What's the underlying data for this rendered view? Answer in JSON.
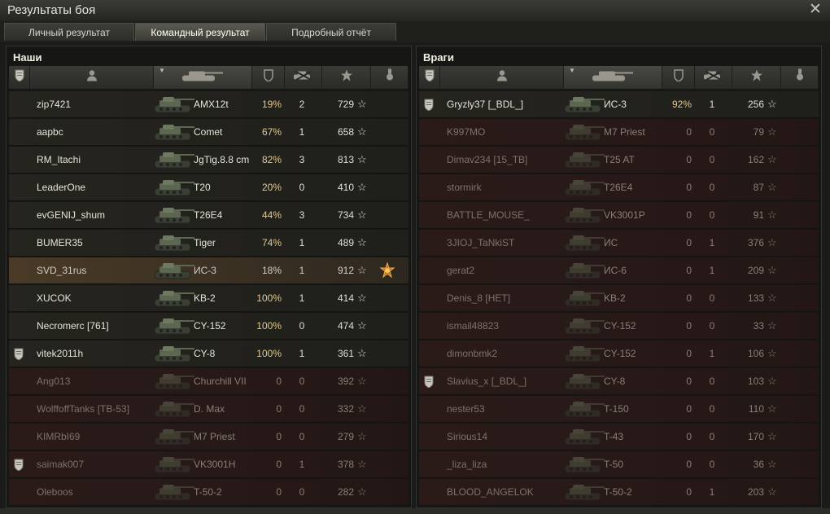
{
  "window": {
    "title": "Результаты боя",
    "close": "✕"
  },
  "tabs": [
    {
      "label": "Личный результат"
    },
    {
      "label": "Командный результат"
    },
    {
      "label": "Подробный отчёт"
    }
  ],
  "colors": {
    "accent_damage": "#e0c892",
    "dead_row": "#2a1b19",
    "own_row": "#4a3a26"
  },
  "teams": [
    {
      "title": "Наши",
      "players": [
        {
          "platoon": false,
          "name": "zip7421",
          "vehicle": "AMX12t",
          "damage": "19%",
          "kills": "2",
          "xp": "729",
          "state": "alive"
        },
        {
          "platoon": false,
          "name": "aapbc",
          "vehicle": "Comet",
          "damage": "67%",
          "kills": "1",
          "xp": "658",
          "state": "alive"
        },
        {
          "platoon": false,
          "name": "RM_Itachi",
          "vehicle": "JgTig.8.8 cm",
          "damage": "82%",
          "kills": "3",
          "xp": "813",
          "state": "alive"
        },
        {
          "platoon": false,
          "name": "LeaderOne",
          "vehicle": "T20",
          "damage": "20%",
          "kills": "0",
          "xp": "410",
          "state": "alive"
        },
        {
          "platoon": false,
          "name": "evGENIJ_shum",
          "vehicle": "T26E4",
          "damage": "44%",
          "kills": "3",
          "xp": "734",
          "state": "alive"
        },
        {
          "platoon": false,
          "name": "BUMER35",
          "vehicle": "Tiger",
          "damage": "74%",
          "kills": "1",
          "xp": "489",
          "state": "alive"
        },
        {
          "platoon": false,
          "name": "SVD_31rus",
          "vehicle": "ИС-3",
          "damage": "18%",
          "kills": "1",
          "xp": "912",
          "state": "me",
          "medal": true
        },
        {
          "platoon": false,
          "name": "XUCOK",
          "vehicle": "KB-2",
          "damage": "100%",
          "kills": "1",
          "xp": "414",
          "state": "alive"
        },
        {
          "platoon": false,
          "name": "Necromerc [761]",
          "vehicle": "CY-152",
          "damage": "100%",
          "kills": "0",
          "xp": "474",
          "state": "alive"
        },
        {
          "platoon": true,
          "name": "vitek2011h",
          "vehicle": "CY-8",
          "damage": "100%",
          "kills": "1",
          "xp": "361",
          "state": "alive"
        },
        {
          "platoon": false,
          "name": "Ang013",
          "vehicle": "Churchill VII",
          "damage": "0",
          "kills": "0",
          "xp": "392",
          "state": "dead"
        },
        {
          "platoon": false,
          "name": "WolffoffTanks [TB-53]",
          "vehicle": "D. Max",
          "damage": "0",
          "kills": "0",
          "xp": "332",
          "state": "dead"
        },
        {
          "platoon": false,
          "name": "KIMRbI69",
          "vehicle": "M7 Priest",
          "damage": "0",
          "kills": "0",
          "xp": "279",
          "state": "dead"
        },
        {
          "platoon": true,
          "name": "saimak007",
          "vehicle": "VK3001H",
          "damage": "0",
          "kills": "1",
          "xp": "378",
          "state": "dead"
        },
        {
          "platoon": false,
          "name": "Oleboos",
          "vehicle": "T-50-2",
          "damage": "0",
          "kills": "0",
          "xp": "282",
          "state": "dead"
        }
      ]
    },
    {
      "title": "Враги",
      "players": [
        {
          "platoon": true,
          "name": "Gryzly37 [_BDL_]",
          "vehicle": "ИС-3",
          "damage": "92%",
          "kills": "1",
          "xp": "256",
          "state": "alive"
        },
        {
          "platoon": false,
          "name": "K997MO",
          "vehicle": "M7 Priest",
          "damage": "0",
          "kills": "0",
          "xp": "79",
          "state": "dead"
        },
        {
          "platoon": false,
          "name": "Dimav234 [15_TB]",
          "vehicle": "T25 AT",
          "damage": "0",
          "kills": "0",
          "xp": "162",
          "state": "dead"
        },
        {
          "platoon": false,
          "name": "stormirk",
          "vehicle": "T26E4",
          "damage": "0",
          "kills": "0",
          "xp": "87",
          "state": "dead"
        },
        {
          "platoon": false,
          "name": "BATTLE_MOUSE_",
          "vehicle": "VK3001P",
          "damage": "0",
          "kills": "0",
          "xp": "91",
          "state": "dead"
        },
        {
          "platoon": false,
          "name": "3JIOJ_TaNkiST",
          "vehicle": "ИС",
          "damage": "0",
          "kills": "1",
          "xp": "376",
          "state": "dead"
        },
        {
          "platoon": false,
          "name": "gerat2",
          "vehicle": "ИС-6",
          "damage": "0",
          "kills": "1",
          "xp": "209",
          "state": "dead"
        },
        {
          "platoon": false,
          "name": "Denis_8 [HET]",
          "vehicle": "KB-2",
          "damage": "0",
          "kills": "0",
          "xp": "133",
          "state": "dead"
        },
        {
          "platoon": false,
          "name": "ismail48823",
          "vehicle": "CY-152",
          "damage": "0",
          "kills": "0",
          "xp": "33",
          "state": "dead"
        },
        {
          "platoon": false,
          "name": "dimonbmk2",
          "vehicle": "CY-152",
          "damage": "0",
          "kills": "1",
          "xp": "106",
          "state": "dead"
        },
        {
          "platoon": true,
          "name": "Slavius_x [_BDL_]",
          "vehicle": "CY-8",
          "damage": "0",
          "kills": "0",
          "xp": "103",
          "state": "dead"
        },
        {
          "platoon": false,
          "name": "nester53",
          "vehicle": "T-150",
          "damage": "0",
          "kills": "0",
          "xp": "110",
          "state": "dead"
        },
        {
          "platoon": false,
          "name": "Sirious14",
          "vehicle": "T-43",
          "damage": "0",
          "kills": "0",
          "xp": "170",
          "state": "dead"
        },
        {
          "platoon": false,
          "name": "_liza_liza",
          "vehicle": "T-50",
          "damage": "0",
          "kills": "0",
          "xp": "36",
          "state": "dead"
        },
        {
          "platoon": false,
          "name": "BLOOD_ANGELOK",
          "vehicle": "T-50-2",
          "damage": "0",
          "kills": "1",
          "xp": "203",
          "state": "dead"
        }
      ]
    }
  ],
  "icons": {
    "platoon": "platoon-shield-icon",
    "player": "player-icon",
    "tank": "tank-icon",
    "damage": "damage-shield-icon",
    "kills": "kills-icon",
    "xp": "star-icon",
    "medal": "medal-icon"
  }
}
